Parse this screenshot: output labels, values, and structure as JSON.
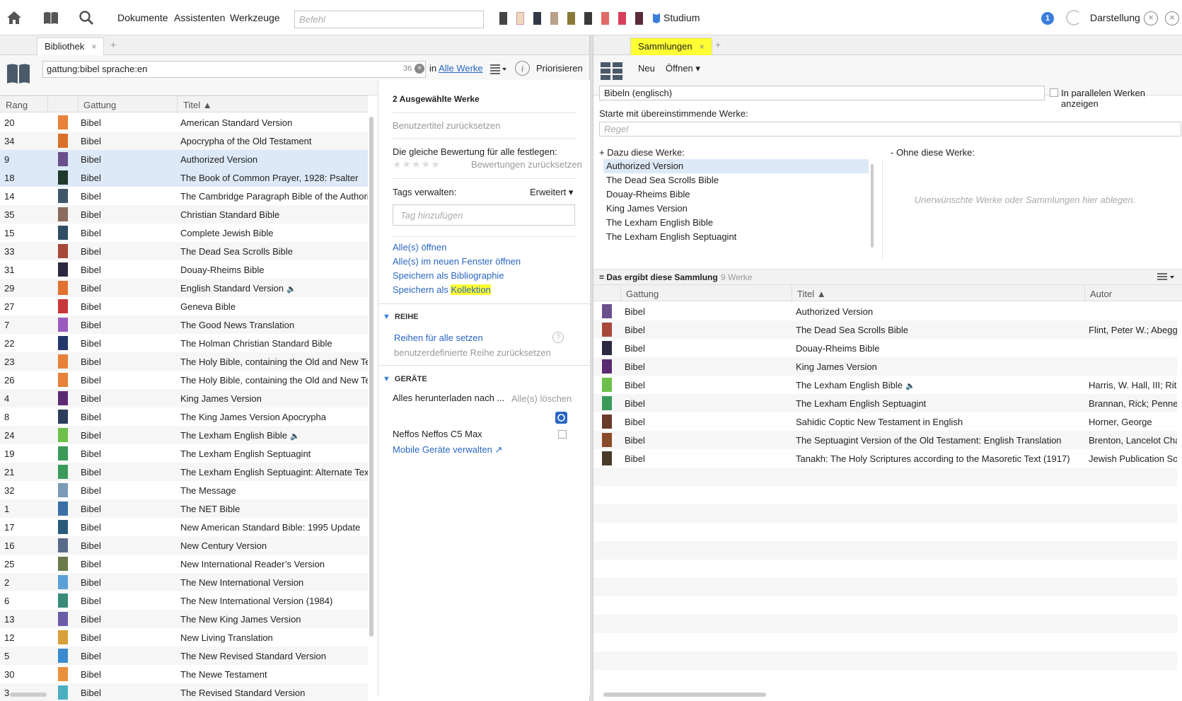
{
  "topbar": {
    "menus": [
      "Dokumente",
      "Assistenten",
      "Werkzeuge"
    ],
    "command_placeholder": "Befehl",
    "layout_name": "Studium",
    "notifications": "1",
    "appearance": "Darstellung",
    "close_symbol": "×"
  },
  "library": {
    "tab_label": "Bibliothek",
    "tab_close": "×",
    "tab_add": "+",
    "search_value": "gattung:bibel sprache:en",
    "result_count": "36",
    "clear_symbol": "×",
    "scope_prefix": "in",
    "scope_link": "Alle Werke",
    "info_symbol": "i",
    "prioritize": "Priorisieren",
    "columns": {
      "rank": "Rang",
      "type": "Gattung",
      "title": "Titel",
      "sort": "▲"
    },
    "rows": [
      {
        "rank": "20",
        "type": "Bibel",
        "title": "American Standard Version",
        "color": "#e8813a",
        "audio": false,
        "selected": false
      },
      {
        "rank": "34",
        "type": "Bibel",
        "title": "Apocrypha of the Old Testament",
        "color": "#d9702a",
        "audio": false,
        "selected": false
      },
      {
        "rank": "9",
        "type": "Bibel",
        "title": "Authorized Version",
        "color": "#6b4f8c",
        "audio": false,
        "selected": true
      },
      {
        "rank": "18",
        "type": "Bibel",
        "title": "The Book of Common Prayer, 1928: Psalter",
        "color": "#1f3a2c",
        "audio": false,
        "selected": true
      },
      {
        "rank": "14",
        "type": "Bibel",
        "title": "The Cambridge Paragraph Bible of the Authorized",
        "color": "#40566b",
        "audio": false,
        "selected": false
      },
      {
        "rank": "35",
        "type": "Bibel",
        "title": "Christian Standard Bible",
        "color": "#8a6d5e",
        "audio": false,
        "selected": false
      },
      {
        "rank": "15",
        "type": "Bibel",
        "title": "Complete Jewish Bible",
        "color": "#2f4e63",
        "audio": false,
        "selected": false
      },
      {
        "rank": "33",
        "type": "Bibel",
        "title": "The Dead Sea Scrolls Bible",
        "color": "#a8483a",
        "audio": false,
        "selected": false
      },
      {
        "rank": "31",
        "type": "Bibel",
        "title": "Douay-Rheims Bible",
        "color": "#2b2840",
        "audio": false,
        "selected": false
      },
      {
        "rank": "29",
        "type": "Bibel",
        "title": "English Standard Version",
        "color": "#e2702e",
        "audio": true,
        "selected": false
      },
      {
        "rank": "27",
        "type": "Bibel",
        "title": "Geneva Bible",
        "color": "#c9363a",
        "audio": false,
        "selected": false
      },
      {
        "rank": "7",
        "type": "Bibel",
        "title": "The Good News Translation",
        "color": "#9a5bbf",
        "audio": false,
        "selected": false
      },
      {
        "rank": "22",
        "type": "Bibel",
        "title": "The Holman Christian Standard Bible",
        "color": "#24356b",
        "audio": false,
        "selected": false
      },
      {
        "rank": "23",
        "type": "Bibel",
        "title": "The Holy Bible, containing the Old and New Testa",
        "color": "#e8813a",
        "audio": false,
        "selected": false
      },
      {
        "rank": "26",
        "type": "Bibel",
        "title": "The Holy Bible, containing the Old and New Testa",
        "color": "#e8813a",
        "audio": false,
        "selected": false
      },
      {
        "rank": "4",
        "type": "Bibel",
        "title": "King James Version",
        "color": "#5c2a70",
        "audio": false,
        "selected": false
      },
      {
        "rank": "8",
        "type": "Bibel",
        "title": "The King James Version Apocrypha",
        "color": "#2c3e5c",
        "audio": false,
        "selected": false
      },
      {
        "rank": "24",
        "type": "Bibel",
        "title": "The Lexham English Bible",
        "color": "#6cc04a",
        "audio": true,
        "selected": false
      },
      {
        "rank": "19",
        "type": "Bibel",
        "title": "The Lexham English Septuagint",
        "color": "#3a9a5a",
        "audio": false,
        "selected": false
      },
      {
        "rank": "21",
        "type": "Bibel",
        "title": "The Lexham English Septuagint: Alternate Texts",
        "color": "#3a9a5a",
        "audio": false,
        "selected": false
      },
      {
        "rank": "32",
        "type": "Bibel",
        "title": "The Message",
        "color": "#7a9ab8",
        "audio": false,
        "selected": false
      },
      {
        "rank": "1",
        "type": "Bibel",
        "title": "The NET Bible",
        "color": "#3a6fa8",
        "audio": false,
        "selected": false
      },
      {
        "rank": "17",
        "type": "Bibel",
        "title": "New American Standard Bible: 1995 Update",
        "color": "#2a5a7a",
        "audio": false,
        "selected": false
      },
      {
        "rank": "16",
        "type": "Bibel",
        "title": "New Century Version",
        "color": "#5a6a8a",
        "audio": false,
        "selected": false
      },
      {
        "rank": "25",
        "type": "Bibel",
        "title": "New International Reader’s Version",
        "color": "#6a7a4a",
        "audio": false,
        "selected": false
      },
      {
        "rank": "2",
        "type": "Bibel",
        "title": "The New International Version",
        "color": "#5aa0d8",
        "audio": false,
        "selected": false
      },
      {
        "rank": "6",
        "type": "Bibel",
        "title": "The New International Version (1984)",
        "color": "#3a8a7a",
        "audio": false,
        "selected": false
      },
      {
        "rank": "13",
        "type": "Bibel",
        "title": "The New King James Version",
        "color": "#6a5aa8",
        "audio": false,
        "selected": false
      },
      {
        "rank": "12",
        "type": "Bibel",
        "title": "New Living Translation",
        "color": "#d8a03a",
        "audio": false,
        "selected": false
      },
      {
        "rank": "5",
        "type": "Bibel",
        "title": "The New Revised Standard Version",
        "color": "#3a8ad0",
        "audio": false,
        "selected": false
      },
      {
        "rank": "30",
        "type": "Bibel",
        "title": "The Newe Testament",
        "color": "#e8903a",
        "audio": false,
        "selected": false
      },
      {
        "rank": "3",
        "type": "Bibel",
        "title": "The Revised Standard Version",
        "color": "#4ab0c0",
        "audio": false,
        "selected": false
      }
    ]
  },
  "detail": {
    "selected_count": "2 Ausgewählte Werke",
    "reset_titles": "Benutzertitel zurücksetzen",
    "rating_label": "Die gleiche Bewertung für alle festlegen:",
    "stars": "★★★★★",
    "reset_ratings": "Bewertungen zurücksetzen",
    "tags_label": "Tags verwalten:",
    "tags_mode": "Erweitert ▾",
    "tag_placeholder": "Tag hinzufügen",
    "open_all": "Alle(s) öffnen",
    "open_all_new_window": "Alle(s) im neuen Fenster öffnen",
    "save_bibliography": "Speichern als Bibliographie",
    "save_as_prefix": "Speichern als",
    "save_as_collection": "Kollektion",
    "series_section": "REIHE",
    "series_set_all": "Reihen für alle setzen",
    "series_help": "?",
    "series_reset": "benutzerdefinierte Reihe zurücksetzen",
    "devices_section": "GERÄTE",
    "download_all": "Alles herunterladen nach ...",
    "delete_all": "Alle(s) löschen",
    "device_name": "Neffos Neffos C5 Max",
    "manage_devices": "Mobile Geräte verwalten"
  },
  "collections": {
    "tab_label": "Sammlungen",
    "tab_close": "×",
    "tab_add": "+",
    "new": "Neu",
    "open": "Öffnen ▾",
    "name_value": "Bibeln (englisch)",
    "parallel_label": "In parallelen Werken anzeigen",
    "start_label": "Starte mit übereinstimmende Werke:",
    "rule_placeholder": "Regel",
    "include_label": "+  Dazu diese Werke:",
    "exclude_label": "-  Ohne diese Werke:",
    "include_items": [
      "Authorized Version",
      "The Dead Sea Scrolls Bible",
      "Douay-Rheims Bible",
      "King James Version",
      "The Lexham English Bible",
      "The Lexham English Septuagint"
    ],
    "drop_hint": "Unerwünschte Werke oder Sammlungen hier ablegen.",
    "result_label": "= Das ergibt diese Sammlung",
    "result_count": "9 Werke",
    "columns": {
      "type": "Gattung",
      "title": "Titel",
      "author": "Autor",
      "sort": "▲"
    },
    "rows": [
      {
        "type": "Bibel",
        "title": "Authorized Version",
        "author": "",
        "color": "#6b4f8c",
        "audio": false
      },
      {
        "type": "Bibel",
        "title": "The Dead Sea Scrolls Bible",
        "author": "Flint, Peter W.; Abegg,",
        "color": "#a8483a",
        "audio": false
      },
      {
        "type": "Bibel",
        "title": "Douay-Rheims Bible",
        "author": "",
        "color": "#2b2840",
        "audio": false
      },
      {
        "type": "Bibel",
        "title": "King James Version",
        "author": "",
        "color": "#5c2a70",
        "audio": false
      },
      {
        "type": "Bibel",
        "title": "The Lexham English Bible",
        "author": "Harris, W. Hall, III; Ritze",
        "color": "#6cc04a",
        "audio": true
      },
      {
        "type": "Bibel",
        "title": "The Lexham English Septuagint",
        "author": "Brannan, Rick; Penner,",
        "color": "#3a9a5a",
        "audio": false
      },
      {
        "type": "Bibel",
        "title": "Sahidic Coptic New Testament in English",
        "author": "Horner, George",
        "color": "#6a3a2a",
        "audio": false
      },
      {
        "type": "Bibel",
        "title": "The Septuagint Version of the Old Testament: English Translation",
        "author": "Brenton, Lancelot Cha",
        "color": "#8a4a2a",
        "audio": false
      },
      {
        "type": "Bibel",
        "title": "Tanakh: The Holy Scriptures according to the Masoretic Text (1917)",
        "author": "Jewish Publication Soc",
        "color": "#4a3a2a",
        "audio": false
      }
    ]
  },
  "colors": {
    "accent": "#2a66c2",
    "selection": "#dde9f7",
    "highlight": "#ffff33"
  }
}
